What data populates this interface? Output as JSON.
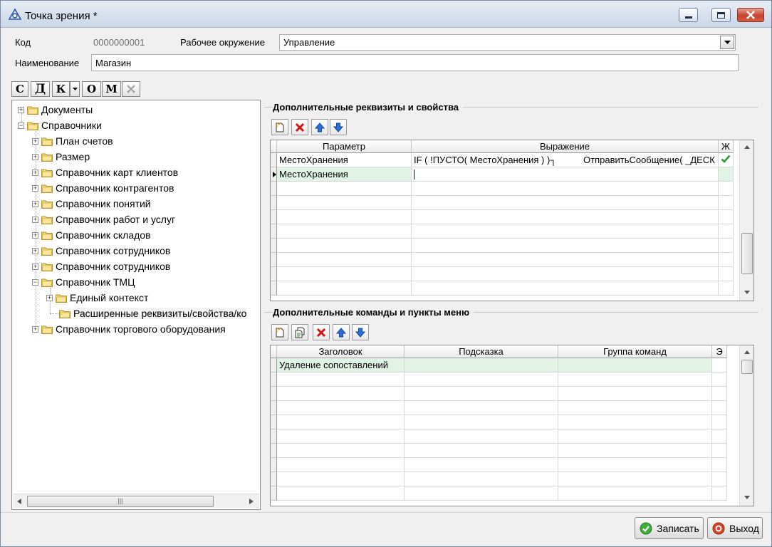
{
  "window": {
    "title": "Точка зрения *"
  },
  "form": {
    "code_label": "Код",
    "code_value": "0000000001",
    "env_label": "Рабочее окружение",
    "env_value": "Управление",
    "name_label": "Наименование",
    "name_value": "Магазин"
  },
  "toolbar": {
    "buttons": [
      "С",
      "Д",
      "К",
      "О",
      "М"
    ]
  },
  "tree": {
    "items": [
      {
        "label": "Документы"
      },
      {
        "label": "Справочники"
      },
      {
        "label": "План счетов"
      },
      {
        "label": "Размер"
      },
      {
        "label": "Справочник карт клиентов"
      },
      {
        "label": "Справочник контрагентов"
      },
      {
        "label": "Справочник понятий"
      },
      {
        "label": "Справочник работ и услуг"
      },
      {
        "label": "Справочник складов"
      },
      {
        "label": "Справочник сотрудников"
      },
      {
        "label": "Справочник сотрудников"
      },
      {
        "label": "Справочник ТМЦ"
      },
      {
        "label": "Единый контекст"
      },
      {
        "label": "Расширенные реквизиты/свойства/ко"
      },
      {
        "label": "Справочник торгового оборудования"
      }
    ]
  },
  "props": {
    "title": "Дополнительные реквизиты и свойства",
    "columns": [
      "Параметр",
      "Выражение",
      "Ж"
    ],
    "rows": [
      {
        "param": "МестоХранения",
        "expr_a": "IF ( !ПУСТО( МестоХранения ) )┐",
        "expr_b": "ОтправитьСообщение( _ДЕСК"
      },
      {
        "param": "МестоХранения",
        "expr_a": "",
        "expr_b": ""
      }
    ]
  },
  "commands": {
    "title": "Дополнительные команды и пункты меню",
    "columns": [
      "Заголовок",
      "Подсказка",
      "Группа команд",
      "Э"
    ],
    "rows": [
      {
        "title": "Удаление сопоставлений",
        "hint": "",
        "group": ""
      }
    ]
  },
  "footer": {
    "save_label": "Записать",
    "exit_label": "Выход"
  },
  "colors": {
    "row_selected": "#e0f3e4",
    "title_close": "#c8412b"
  }
}
